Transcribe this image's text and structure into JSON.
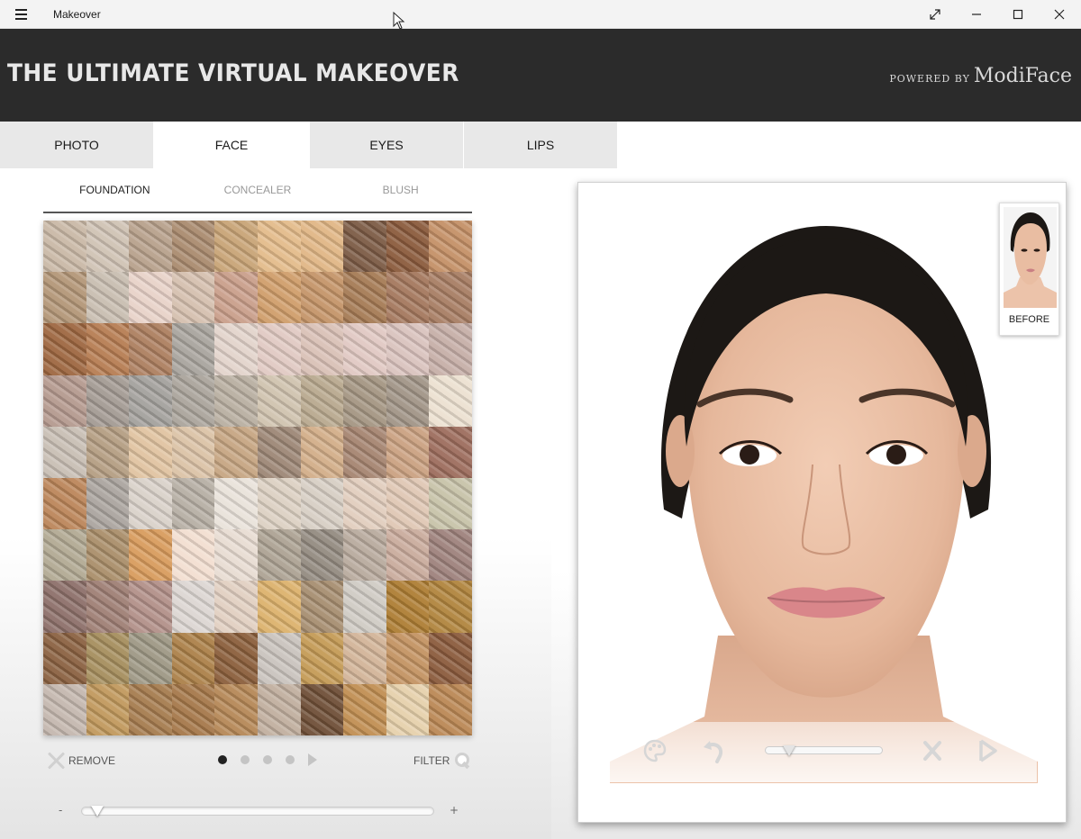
{
  "window": {
    "title": "Makeover",
    "controls": [
      "fullscreen-icon",
      "minimize-icon",
      "maximize-icon",
      "close-icon"
    ]
  },
  "header": {
    "title": "THE ULTIMATE VIRTUAL MAKEOVER",
    "powered_by": "POWERED BY",
    "brand": "ModiFace"
  },
  "tabs": [
    {
      "label": "PHOTO",
      "active": false
    },
    {
      "label": "FACE",
      "active": true
    },
    {
      "label": "EYES",
      "active": false
    },
    {
      "label": "LIPS",
      "active": false
    }
  ],
  "subtabs": [
    {
      "label": "FOUNDATION",
      "active": true
    },
    {
      "label": "CONCEALER",
      "active": false
    },
    {
      "label": "BLUSH",
      "active": false
    }
  ],
  "swatches": [
    "#c9b8a6",
    "#cfc2b4",
    "#b7a08b",
    "#a98a6e",
    "#c8a476",
    "#e3bb8a",
    "#e0b685",
    "#7b5a44",
    "#8a5a3c",
    "#c49066",
    "#b39677",
    "#c8bdb0",
    "#e8d2c8",
    "#d5bfae",
    "#c99e8a",
    "#cf9d6a",
    "#c49468",
    "#a57a54",
    "#a4775d",
    "#a77d63",
    "#9d6640",
    "#b67c52",
    "#ac7e5f",
    "#a8a49d",
    "#e2d3cb",
    "#e0c9c2",
    "#d9c0b6",
    "#e0c8c2",
    "#d9c2bd",
    "#c6aea7",
    "#b4998e",
    "#a39a93",
    "#a3a09c",
    "#aaa49b",
    "#b8aea0",
    "#cfc2ae",
    "#b8a88e",
    "#a49582",
    "#a09486",
    "#ece0d0",
    "#c8beb4",
    "#b49d82",
    "#e0c3a0",
    "#dbc2a6",
    "#c6a582",
    "#9c8675",
    "#d2ad88",
    "#a58470",
    "#caa181",
    "#9c6c5c",
    "#bb8559",
    "#aaa49e",
    "#d9d1c9",
    "#b6aea4",
    "#e9e2da",
    "#dcd0c2",
    "#d7cec4",
    "#e1cdbd",
    "#dfc7b4",
    "#c7c2a8",
    "#b1a993",
    "#a98d69",
    "#d89b5c",
    "#f2ded0",
    "#e8dcd2",
    "#aca293",
    "#938a80",
    "#b8aa9d",
    "#c9ab9c",
    "#9d817b",
    "#8c6f69",
    "#9e7e74",
    "#b18f88",
    "#dcd6d2",
    "#e1cfc1",
    "#dcb16c",
    "#a68d70",
    "#cfcbc4",
    "#ad7d33",
    "#b0843d",
    "#8a6141",
    "#a58d5d",
    "#9d9784",
    "#ab8048",
    "#8a5e3b",
    "#c9c3bd",
    "#c49a55",
    "#d2b498",
    "#c39362",
    "#8a5a3c",
    "#c4b7ae",
    "#c0985c",
    "#a57b4e",
    "#a57749",
    "#b58756",
    "#c0ae9e",
    "#6e4e36",
    "#c08e52",
    "#e6d0ab",
    "#ba8754"
  ],
  "controls": {
    "remove_label": "REMOVE",
    "filter_label": "FILTER",
    "pager_dots": 4,
    "pager_active": 0,
    "slider_min_label": "-",
    "slider_max_label": "+",
    "intensity": 0.03
  },
  "preview": {
    "before_label": "BEFORE",
    "toolbar_icons": [
      "palette-icon",
      "undo-icon",
      "reset-icon",
      "share-icon"
    ],
    "toolbar_slider_value": 0.15
  }
}
